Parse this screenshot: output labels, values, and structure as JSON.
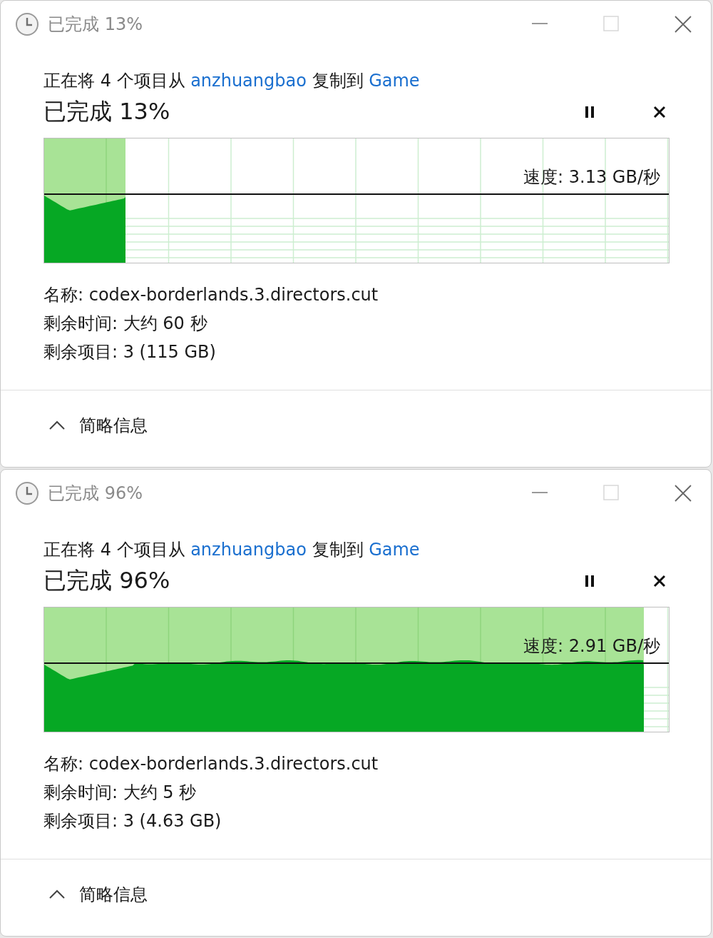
{
  "dialogs": [
    {
      "window": {
        "title": "已完成 13%"
      },
      "description": [
        {
          "kind": "text",
          "text": "正在将 4 个项目从 "
        },
        {
          "kind": "link",
          "text": "anzhuangbao"
        },
        {
          "kind": "text",
          "text": " 复制到 "
        },
        {
          "kind": "link",
          "text": "Game"
        }
      ],
      "progress": {
        "label": "已完成 13%",
        "level": 0.13
      },
      "speed": "速度: 3.13 GB/秒",
      "details": [
        "名称: codex-borderlands.3.directors.cut",
        "剩余时间: 大约 60 秒",
        "剩余项目: 3 (115 GB)"
      ],
      "footer": {
        "label": "简略信息",
        "expanded": true
      }
    },
    {
      "window": {
        "title": "已完成 96%"
      },
      "description": [
        {
          "kind": "text",
          "text": "正在将 4 个项目从 "
        },
        {
          "kind": "link",
          "text": "anzhuangbao"
        },
        {
          "kind": "text",
          "text": " 复制到 "
        },
        {
          "kind": "link",
          "text": "Game"
        }
      ],
      "progress": {
        "label": "已完成 96%",
        "level": 0.96
      },
      "speed": "速度: 2.91 GB/秒",
      "details": [
        "名称: codex-borderlands.3.directors.cut",
        "剩余时间: 大约 5 秒",
        "剩余项目: 3 (4.63 GB)"
      ],
      "footer": {
        "label": "简略信息",
        "expanded": true
      }
    }
  ]
}
